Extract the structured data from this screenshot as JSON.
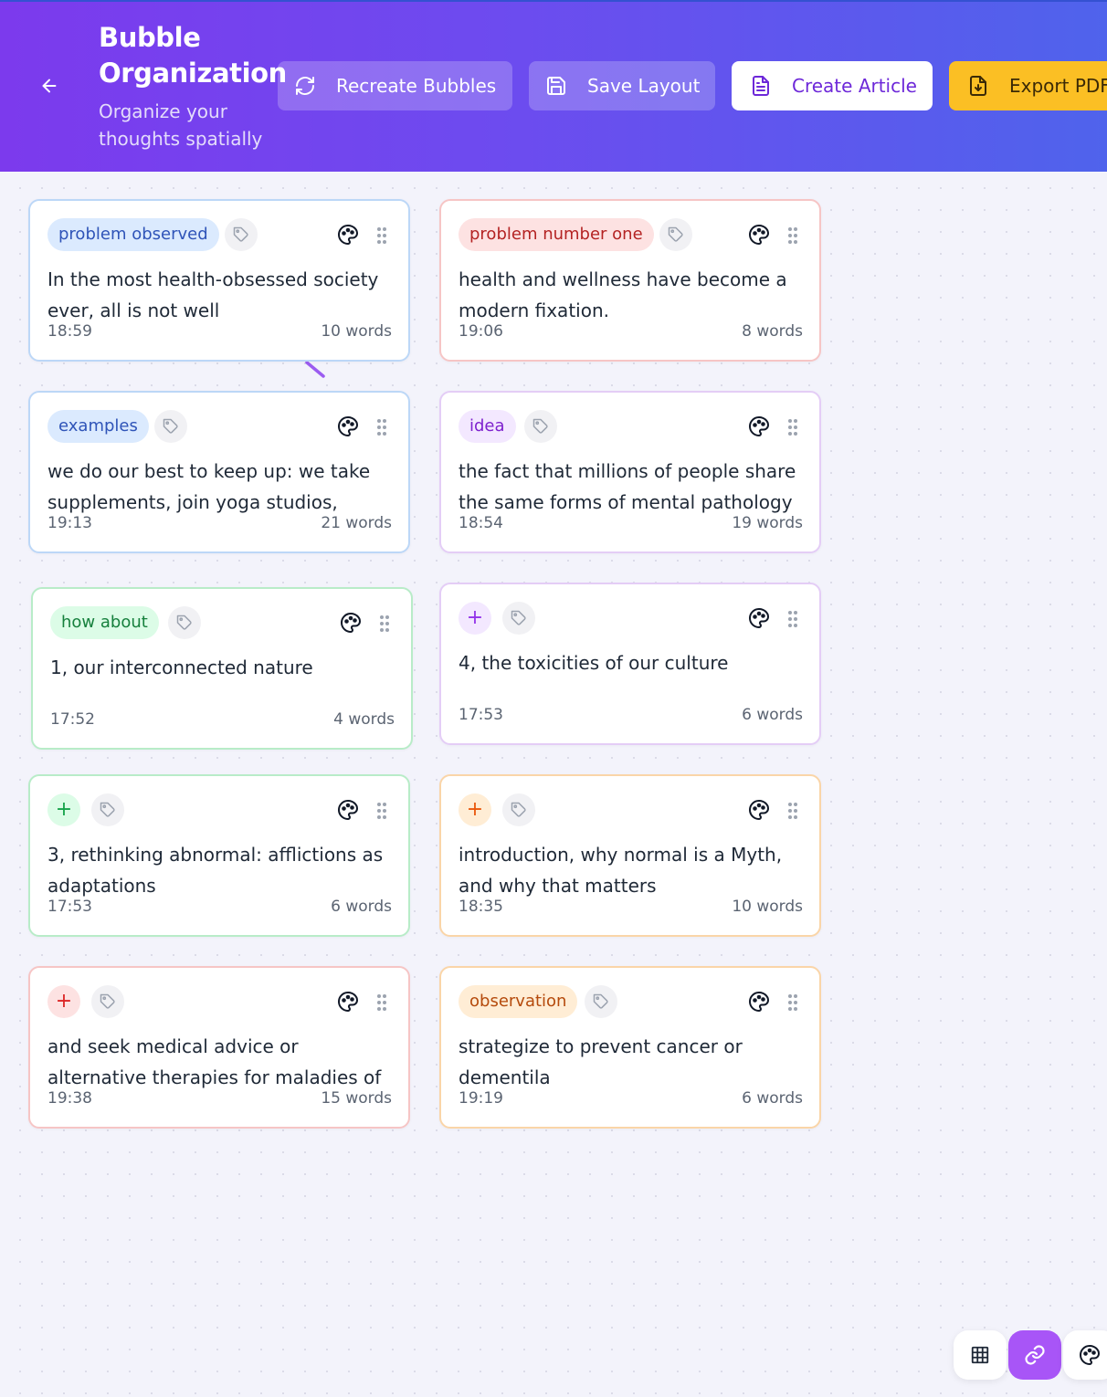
{
  "header": {
    "title": "Bubble Organization",
    "subtitle": "Organize your thoughts spatially",
    "buttons": {
      "recreate": "Recreate Bubbles",
      "save": "Save Layout",
      "article": "Create Article",
      "export": "Export PDF"
    }
  },
  "colors": {
    "header_gradient_start": "#7c3aed",
    "header_gradient_end": "#4f63ec",
    "export_button": "#fbbf24",
    "active_tool": "#a855f7"
  },
  "bubbles": [
    {
      "tag": "problem observed",
      "text": "In the most health-obsessed society ever, all is not well",
      "time": "18:59",
      "words": "10 words",
      "color": "blue"
    },
    {
      "tag": "problem number one",
      "text": "health and wellness have become a modern fixation.",
      "time": "19:06",
      "words": "8 words",
      "color": "red"
    },
    {
      "tag": "examples",
      "text": "we do our best to keep up: we take supplements, join yoga studios,",
      "time": "19:13",
      "words": "21 words",
      "color": "blue"
    },
    {
      "tag": "idea",
      "text": "the fact that millions of people share the same forms of mental pathology",
      "time": "18:54",
      "words": "19 words",
      "color": "purple"
    },
    {
      "tag": "how about",
      "text": "1, our interconnected nature",
      "time": "17:52",
      "words": "4 words",
      "color": "green"
    },
    {
      "tag": "+",
      "text": "4, the toxicities of our culture",
      "time": "17:53",
      "words": "6 words",
      "color": "purple"
    },
    {
      "tag": "+",
      "text": "3, rethinking abnormal: afflictions as adaptations",
      "time": "17:53",
      "words": "6 words",
      "color": "green"
    },
    {
      "tag": "+",
      "text": "introduction, why normal is a Myth, and why that matters",
      "time": "18:35",
      "words": "10 words",
      "color": "orange"
    },
    {
      "tag": "+",
      "text": "and seek medical advice or alternative therapies for maladies of",
      "time": "19:38",
      "words": "15 words",
      "color": "red"
    },
    {
      "tag": "observation",
      "text": "strategize to prevent cancer or dementila",
      "time": "19:19",
      "words": "6 words",
      "color": "orange"
    }
  ],
  "icons": {
    "back": "arrow-left-icon",
    "recreate": "refresh-icon",
    "save": "save-icon",
    "article": "document-icon",
    "export": "file-download-icon",
    "tag_add": "tag-icon",
    "palette": "palette-icon",
    "drag": "drag-handle-icon",
    "toolbar": [
      "grid-icon",
      "link-icon",
      "palette-icon"
    ]
  }
}
